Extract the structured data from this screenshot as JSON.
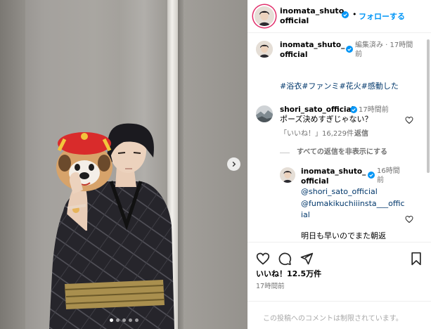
{
  "post": {
    "username": "inomata_shuto_official",
    "follow_label": "フォローする",
    "dot": "•"
  },
  "caption": {
    "username": "inomata_shuto_official",
    "meta": "編集済み · 17時間前",
    "hashtags": [
      "#浴衣",
      "#ファンミ",
      "#花火",
      "#感動した"
    ]
  },
  "comments": [
    {
      "username": "shori_sato_official",
      "time": "17時間前",
      "text": "ポーズ決めすぎじゃない？",
      "likes": "「いいね！」16,229件",
      "reply_label": "返信",
      "toggle_replies": "すべての返信を非表示にする"
    }
  ],
  "reply": {
    "username": "inomata_shuto_official",
    "time": "16時間前",
    "mention1": "@shori_sato_official",
    "mention2": "@fumakikuchiiinsta___official",
    "text": "明日も早いのでまた朝返"
  },
  "footer": {
    "likes": "いいね！12.5万件",
    "time": "17時間前",
    "restricted": "この投稿へのコメントは制限されています。"
  },
  "carousel": {
    "current": 1,
    "total": 5
  },
  "colors": {
    "link": "#00376b",
    "follow": "#0095f6",
    "verified": "#0095f6"
  },
  "icons": [
    "chevron-right-icon",
    "verified-badge-icon",
    "heart-icon",
    "comment-icon",
    "share-icon",
    "bookmark-icon"
  ]
}
